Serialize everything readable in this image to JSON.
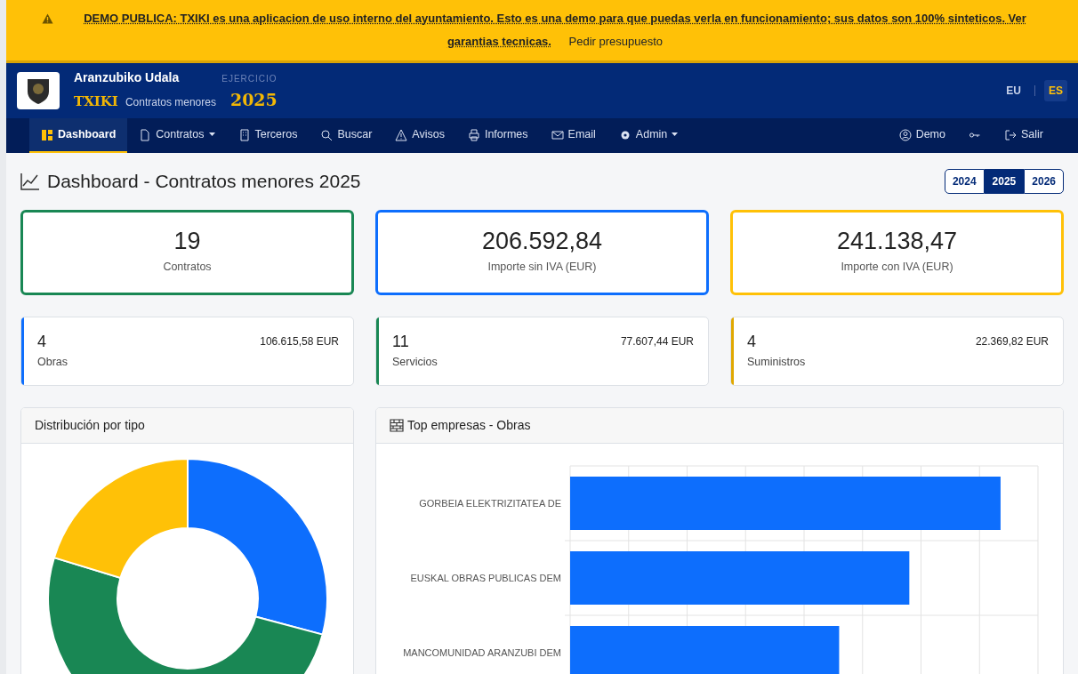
{
  "banner": {
    "text": "**DEMO PUBLICA: TXIKI es una aplicacion de uso interno del ayuntamiento. Esto es una demo para que puedas verla en funcionamiento; sus datos son 100% sinteticos. Ver garantias tecnicas.**",
    "link": "Pedir presupuesto"
  },
  "header": {
    "org": "Aranzubiko Udala",
    "app": "TXIKI",
    "subtitle": "Contratos menores",
    "year_label": "EJERCICIO",
    "year": "2025",
    "languages": [
      {
        "label": "EU",
        "selected": false
      },
      {
        "label": "ES",
        "selected": true
      }
    ]
  },
  "nav": {
    "items": [
      {
        "label": "Dashboard",
        "selected": true,
        "dropdown": false
      },
      {
        "label": "Contratos",
        "selected": false,
        "dropdown": true
      },
      {
        "label": "Terceros",
        "selected": false,
        "dropdown": false
      },
      {
        "label": "Buscar",
        "selected": false,
        "dropdown": false
      },
      {
        "label": "Avisos",
        "selected": false,
        "dropdown": false
      },
      {
        "label": "Informes",
        "selected": false,
        "dropdown": false
      },
      {
        "label": "Email",
        "selected": false,
        "dropdown": false
      },
      {
        "label": "Admin",
        "selected": false,
        "dropdown": true
      }
    ],
    "right": [
      {
        "label": "Demo"
      },
      {
        "label": "Salir"
      }
    ]
  },
  "page": {
    "title": "Dashboard - Contratos menores 2025",
    "years": [
      {
        "label": "2024",
        "selected": false
      },
      {
        "label": "2025",
        "selected": true
      },
      {
        "label": "2026",
        "selected": false
      }
    ]
  },
  "kpis": [
    {
      "value": "19",
      "label": "Contratos",
      "color": "#198754"
    },
    {
      "value": "206.592,84",
      "label": "Importe sin IVA (EUR)",
      "color": "#0d6efd"
    },
    {
      "value": "241.138,47",
      "label": "Importe con IVA (EUR)",
      "color": "#ffc107"
    }
  ],
  "types": [
    {
      "count": "4",
      "label": "Obras",
      "amount": "106.615,58 EUR",
      "color": "#0d6efd"
    },
    {
      "count": "11",
      "label": "Servicios",
      "amount": "77.607,44 EUR",
      "color": "#198754"
    },
    {
      "count": "4",
      "label": "Suministros",
      "amount": "22.369,82 EUR",
      "color": "#e0a800"
    }
  ],
  "donut_panel": {
    "title": "Distribución por tipo"
  },
  "bar_panel": {
    "title": "Top empresas - Obras",
    "categories": [
      "GORBEIA ELEKTRIZITATEA DE",
      "EUSKAL OBRAS PUBLICAS DEM",
      "MANCOMUNIDAD ARANZUBI DEM"
    ]
  }
}
